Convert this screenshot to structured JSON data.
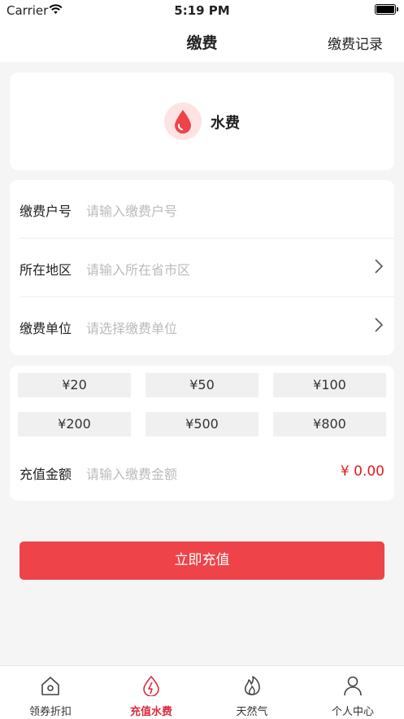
{
  "status_bar": {
    "carrier": "Carrier",
    "time": "5:19 PM"
  },
  "nav": {
    "title": "缴费",
    "record": "缴费记录"
  },
  "service": {
    "name": "水费",
    "icon": "water-drop-icon",
    "accent": "#ee4349"
  },
  "form": [
    {
      "label": "缴费户号",
      "placeholder": "请输入缴费户号",
      "has_arrow": false
    },
    {
      "label": "所在地区",
      "placeholder": "请输入所在省市区",
      "has_arrow": true
    },
    {
      "label": "缴费单位",
      "placeholder": "请选择缴费单位",
      "has_arrow": true
    }
  ],
  "amounts": [
    "¥20",
    "¥50",
    "¥100",
    "¥200",
    "¥500",
    "¥800"
  ],
  "recharge": {
    "label": "充值金额",
    "placeholder": "请输入缴费金额",
    "total": "¥ 0.00"
  },
  "submit_label": "立即充值",
  "tabs": [
    {
      "label": "领券折扣",
      "icon": "home-icon",
      "active": false
    },
    {
      "label": "充值水费",
      "icon": "lightning-icon",
      "active": true
    },
    {
      "label": "天然气",
      "icon": "flame-icon",
      "active": false
    },
    {
      "label": "个人中心",
      "icon": "person-icon",
      "active": false
    }
  ],
  "colors": {
    "primary": "#ee4349",
    "active_tab": "#d92c41",
    "price": "#e51c1c"
  }
}
